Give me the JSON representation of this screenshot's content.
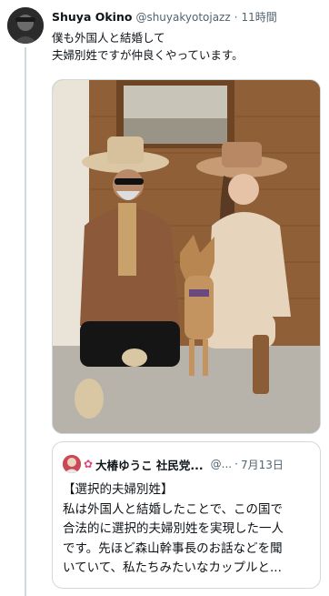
{
  "tweet": {
    "author_name": "Shuya Okino",
    "handle": "@shuyakyotojazz",
    "separator": "·",
    "time": "11時間",
    "text_lines": [
      "僕も外国人と結婚して",
      "夫婦別姓ですが仲良くやっています。"
    ]
  },
  "quote": {
    "author_name": "大椿ゆうこ 社民党...",
    "handle": "@...",
    "separator": "·",
    "date": "7月13日",
    "text_lines": [
      "【選択的夫婦別姓】",
      "私は外国人と結婚したことで、この国で",
      "合法的に選択的夫婦別姓を実現した一人",
      "です。先ほど森山幹事長のお話などを聞",
      "いていて、私たちみたいなカップルと..."
    ]
  },
  "icons": {
    "avatar": "user-avatar",
    "quote_avatar": "user-avatar",
    "flower": "flower-icon"
  },
  "colors": {
    "border": "#cfd9de",
    "secondary_text": "#536471",
    "flower": "#e0457b"
  }
}
